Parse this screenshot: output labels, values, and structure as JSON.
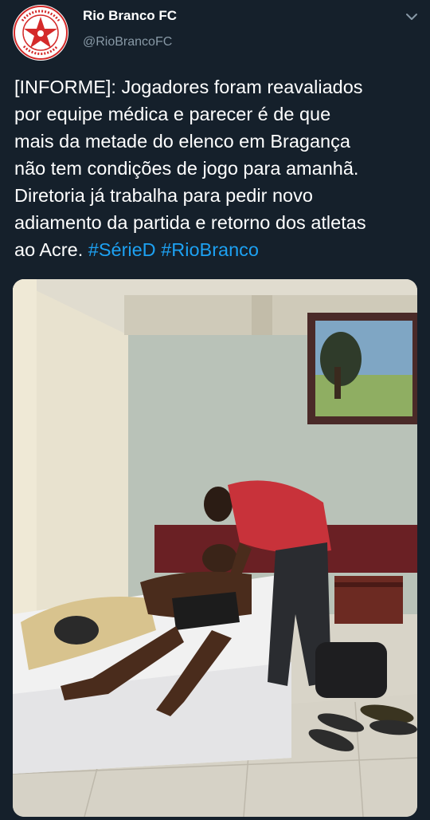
{
  "account": {
    "name": "Rio Branco FC",
    "handle": "@RioBrancoFC",
    "avatar_icon": "club-crest-icon",
    "avatar_text": "RIO BRANCO FOOTBALL CLUB ACRE"
  },
  "menu_icon": "chevron-down-icon",
  "tweet": {
    "body": "[INFORME]: Jogadores foram reavaliados\npor equipe médica e parecer é de que\nmais da metade do elenco em Bragança\nnão tem condições de jogo para amanhã.\nDiretoria já trabalha para pedir novo\nadiamento da partida e retorno dos atletas\nao Acre. ",
    "hashtags": [
      "#SérieD",
      "#RioBranco"
    ]
  },
  "media": {
    "icon": "photo-icon"
  },
  "colors": {
    "background": "#15202b",
    "text": "#ffffff",
    "secondary": "#8899a6",
    "link": "#1da1f2",
    "crest_red": "#d42a2a"
  }
}
